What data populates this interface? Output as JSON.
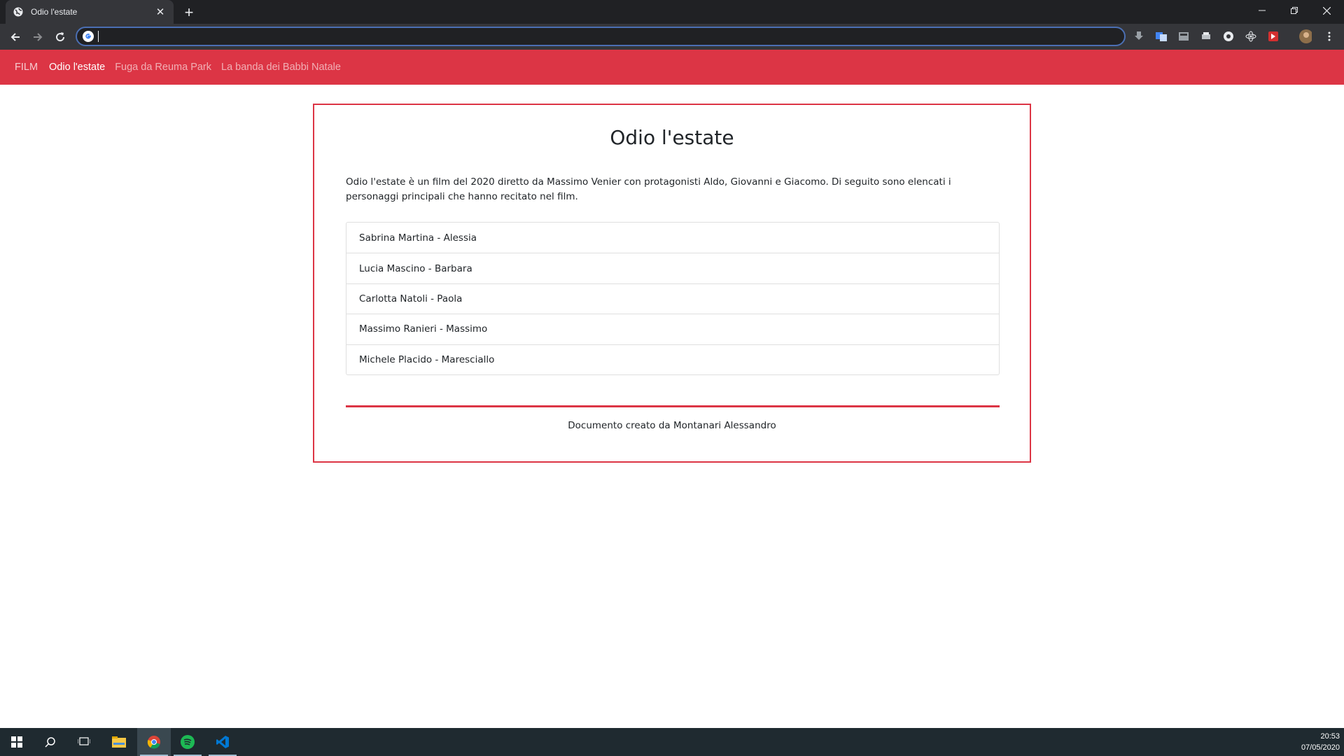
{
  "browser": {
    "tab_title": "Odio l'estate",
    "omnibox_value": ""
  },
  "navbar": {
    "brand": "FILM",
    "links": [
      {
        "label": "Odio l'estate",
        "active": true
      },
      {
        "label": "Fuga da Reuma Park",
        "active": false
      },
      {
        "label": "La banda dei Babbi Natale",
        "active": false
      }
    ]
  },
  "main": {
    "title": "Odio l'estate",
    "description": "Odio l'estate è un film del 2020 diretto da Massimo Venier con protagonisti Aldo, Giovanni e Giacomo. Di seguito sono elencati i personaggi principali che hanno recitato nel film.",
    "cast": [
      "Sabrina Martina - Alessia",
      "Lucia Mascino - Barbara",
      "Carlotta Natoli - Paola",
      "Massimo Ranieri - Massimo",
      "Michele Placido - Maresciallo"
    ],
    "footer": "Documento creato da Montanari Alessandro"
  },
  "taskbar": {
    "time": "20:53",
    "date": "07/05/2020"
  },
  "colors": {
    "accent": "#dc3545",
    "chrome_dark": "#202124",
    "chrome_toolbar": "#35363a"
  }
}
